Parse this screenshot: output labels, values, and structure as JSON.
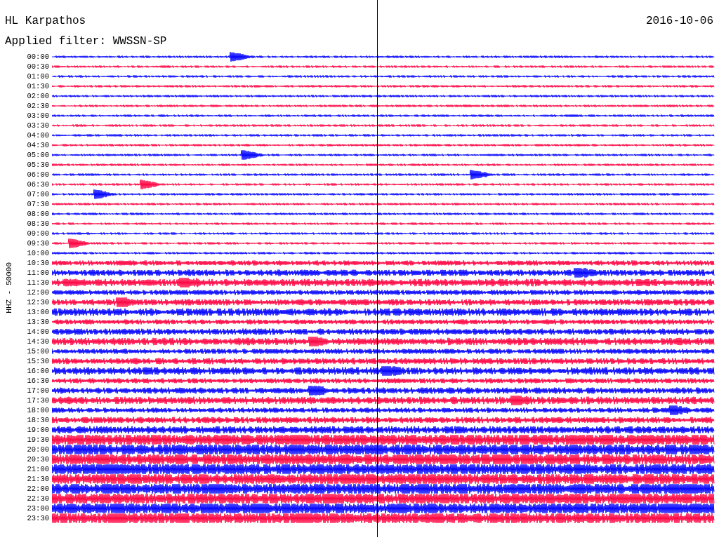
{
  "station": "HL Karpathos",
  "date": "2016-10-06",
  "filter": "Applied filter: WWSSN-SP",
  "axis_label": "HHZ - 50000",
  "rows": [
    {
      "time": "00:00",
      "color": "#0000ff"
    },
    {
      "time": "00:30",
      "color": "#ff0040"
    },
    {
      "time": "01:00",
      "color": "#0000ff"
    },
    {
      "time": "01:30",
      "color": "#ff0040"
    },
    {
      "time": "02:00",
      "color": "#0000ff"
    },
    {
      "time": "02:30",
      "color": "#ff0040"
    },
    {
      "time": "03:00",
      "color": "#0000ff"
    },
    {
      "time": "03:30",
      "color": "#ff0040"
    },
    {
      "time": "04:00",
      "color": "#0000ff"
    },
    {
      "time": "04:30",
      "color": "#ff0040"
    },
    {
      "time": "05:00",
      "color": "#0000ff"
    },
    {
      "time": "05:30",
      "color": "#ff0040"
    },
    {
      "time": "06:00",
      "color": "#0000ff"
    },
    {
      "time": "06:30",
      "color": "#ff0040"
    },
    {
      "time": "07:00",
      "color": "#0000ff"
    },
    {
      "time": "07:30",
      "color": "#ff0040"
    },
    {
      "time": "08:00",
      "color": "#0000ff"
    },
    {
      "time": "08:30",
      "color": "#ff0040"
    },
    {
      "time": "09:00",
      "color": "#0000ff"
    },
    {
      "time": "09:30",
      "color": "#ff0040"
    },
    {
      "time": "10:00",
      "color": "#0000ff"
    },
    {
      "time": "10:30",
      "color": "#ff0040"
    },
    {
      "time": "11:00",
      "color": "#0000ff"
    },
    {
      "time": "11:30",
      "color": "#ff0040"
    },
    {
      "time": "12:00",
      "color": "#0000ff"
    },
    {
      "time": "12:30",
      "color": "#ff0040"
    },
    {
      "time": "13:00",
      "color": "#0000ff"
    },
    {
      "time": "13:30",
      "color": "#ff0040"
    },
    {
      "time": "14:00",
      "color": "#0000ff"
    },
    {
      "time": "14:30",
      "color": "#ff0040"
    },
    {
      "time": "15:00",
      "color": "#0000ff"
    },
    {
      "time": "15:30",
      "color": "#ff0040"
    },
    {
      "time": "16:00",
      "color": "#0000ff"
    },
    {
      "time": "16:30",
      "color": "#ff0040"
    },
    {
      "time": "17:00",
      "color": "#0000ff"
    },
    {
      "time": "17:30",
      "color": "#ff0040"
    },
    {
      "time": "18:00",
      "color": "#0000ff"
    },
    {
      "time": "18:30",
      "color": "#ff0040"
    },
    {
      "time": "19:00",
      "color": "#0000ff"
    },
    {
      "time": "19:30",
      "color": "#ff0040"
    },
    {
      "time": "20:00",
      "color": "#0000ff"
    },
    {
      "time": "20:30",
      "color": "#ff0040"
    },
    {
      "time": "21:00",
      "color": "#0000ff"
    },
    {
      "time": "21:30",
      "color": "#ff0040"
    },
    {
      "time": "22:00",
      "color": "#0000ff"
    },
    {
      "time": "22:30",
      "color": "#ff0040"
    },
    {
      "time": "23:00",
      "color": "#0000ff"
    },
    {
      "time": "23:30",
      "color": "#ff0040"
    }
  ]
}
